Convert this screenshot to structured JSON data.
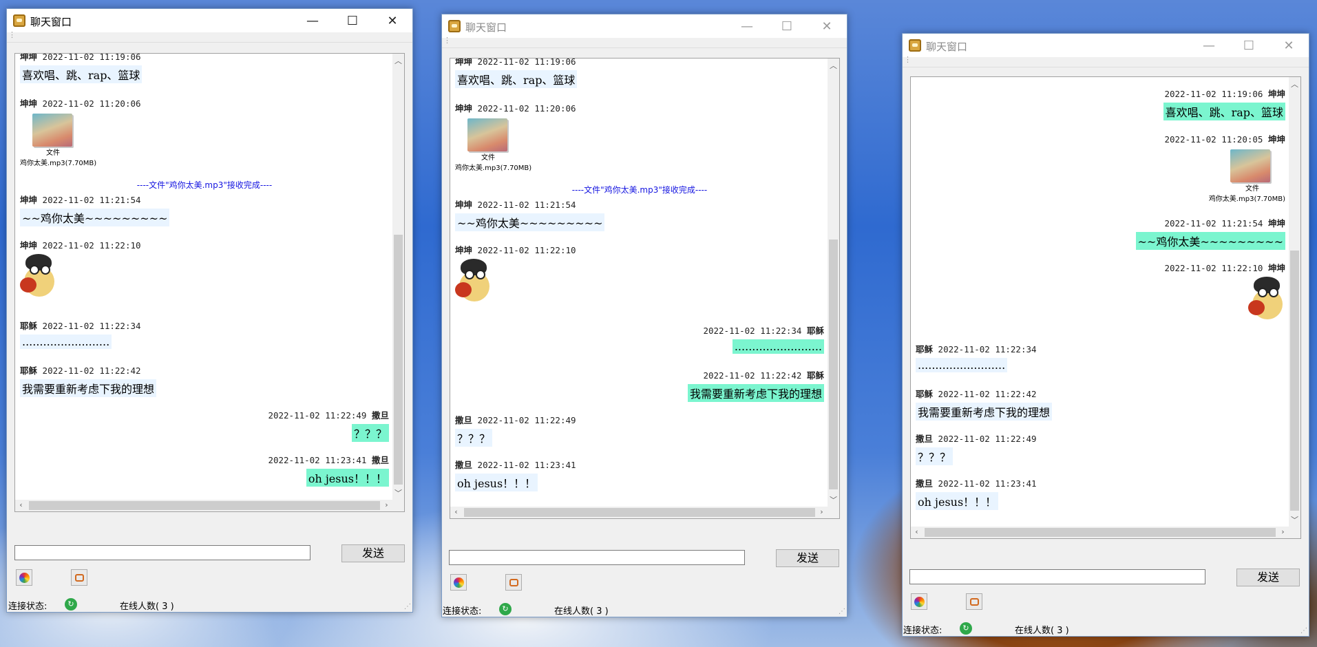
{
  "window_title": "聊天窗口",
  "controls": {
    "minimize": "—",
    "maximize": "☐",
    "close": "✕"
  },
  "send_label": "发送",
  "status": {
    "connection_label": "连接状态:",
    "online_label": "在线人数( 3 )"
  },
  "file": {
    "thumb_label": "文件",
    "name": "鸡你太美.mp3(7.70MB)"
  },
  "system_line": "----文件\"鸡你太美.mp3\"接收完成----",
  "win1": {
    "m1": {
      "name": "坤坤",
      "time": "2022-11-02 11:19:06",
      "text": "喜欢唱、跳、rap、篮球"
    },
    "m2": {
      "name": "坤坤",
      "time": "2022-11-02 11:20:06"
    },
    "m3": {
      "name": "坤坤",
      "time": "2022-11-02 11:21:54",
      "text": "~~鸡你太美~~~~~~~~~"
    },
    "m4": {
      "name": "坤坤",
      "time": "2022-11-02 11:22:10"
    },
    "m5": {
      "name": "耶稣",
      "time": "2022-11-02 11:22:34",
      "text": "........................."
    },
    "m6": {
      "name": "耶稣",
      "time": "2022-11-02 11:22:42",
      "text": "我需要重新考虑下我的理想"
    },
    "m7": {
      "name": "撒旦",
      "time": "2022-11-02 11:22:49",
      "text": "？？？"
    },
    "m8": {
      "name": "撒旦",
      "time": "2022-11-02 11:23:41",
      "text": "oh jesus！！！"
    }
  },
  "win2": {
    "m1": {
      "name": "坤坤",
      "time": "2022-11-02 11:19:06",
      "text": "喜欢唱、跳、rap、篮球"
    },
    "m2": {
      "name": "坤坤",
      "time": "2022-11-02 11:20:06"
    },
    "m3": {
      "name": "坤坤",
      "time": "2022-11-02 11:21:54",
      "text": "~~鸡你太美~~~~~~~~~"
    },
    "m4": {
      "name": "坤坤",
      "time": "2022-11-02 11:22:10"
    },
    "m5": {
      "name": "耶稣",
      "time": "2022-11-02 11:22:34",
      "text": "........................."
    },
    "m6": {
      "name": "耶稣",
      "time": "2022-11-02 11:22:42",
      "text": "我需要重新考虑下我的理想"
    },
    "m7": {
      "name": "撒旦",
      "time": "2022-11-02 11:22:49",
      "text": "？？？"
    },
    "m8": {
      "name": "撒旦",
      "time": "2022-11-02 11:23:41",
      "text": "oh jesus！！！"
    }
  },
  "win3": {
    "m1": {
      "name": "坤坤",
      "time": "2022-11-02 11:19:06",
      "text": "喜欢唱、跳、rap、篮球"
    },
    "m2": {
      "name": "坤坤",
      "time": "2022-11-02 11:20:05"
    },
    "m3": {
      "name": "坤坤",
      "time": "2022-11-02 11:21:54",
      "text": "~~鸡你太美~~~~~~~~~"
    },
    "m4": {
      "name": "坤坤",
      "time": "2022-11-02 11:22:10"
    },
    "m5": {
      "name": "耶稣",
      "time": "2022-11-02 11:22:34",
      "text": "........................."
    },
    "m6": {
      "name": "耶稣",
      "time": "2022-11-02 11:22:42",
      "text": "我需要重新考虑下我的理想"
    },
    "m7": {
      "name": "撒旦",
      "time": "2022-11-02 11:22:49",
      "text": "？？？"
    },
    "m8": {
      "name": "撒旦",
      "time": "2022-11-02 11:23:41",
      "text": "oh jesus！！！"
    }
  },
  "colors": {
    "own_bubble": "#7bf5cf",
    "other_bubble": "#e9f4ff",
    "system_text": "#1414e0",
    "connected": "#2fa84a"
  },
  "icons": {
    "app": "chat-app-icon",
    "emoji": "emoji-icon",
    "image": "image-icon",
    "connection": "connection-ok-icon"
  }
}
